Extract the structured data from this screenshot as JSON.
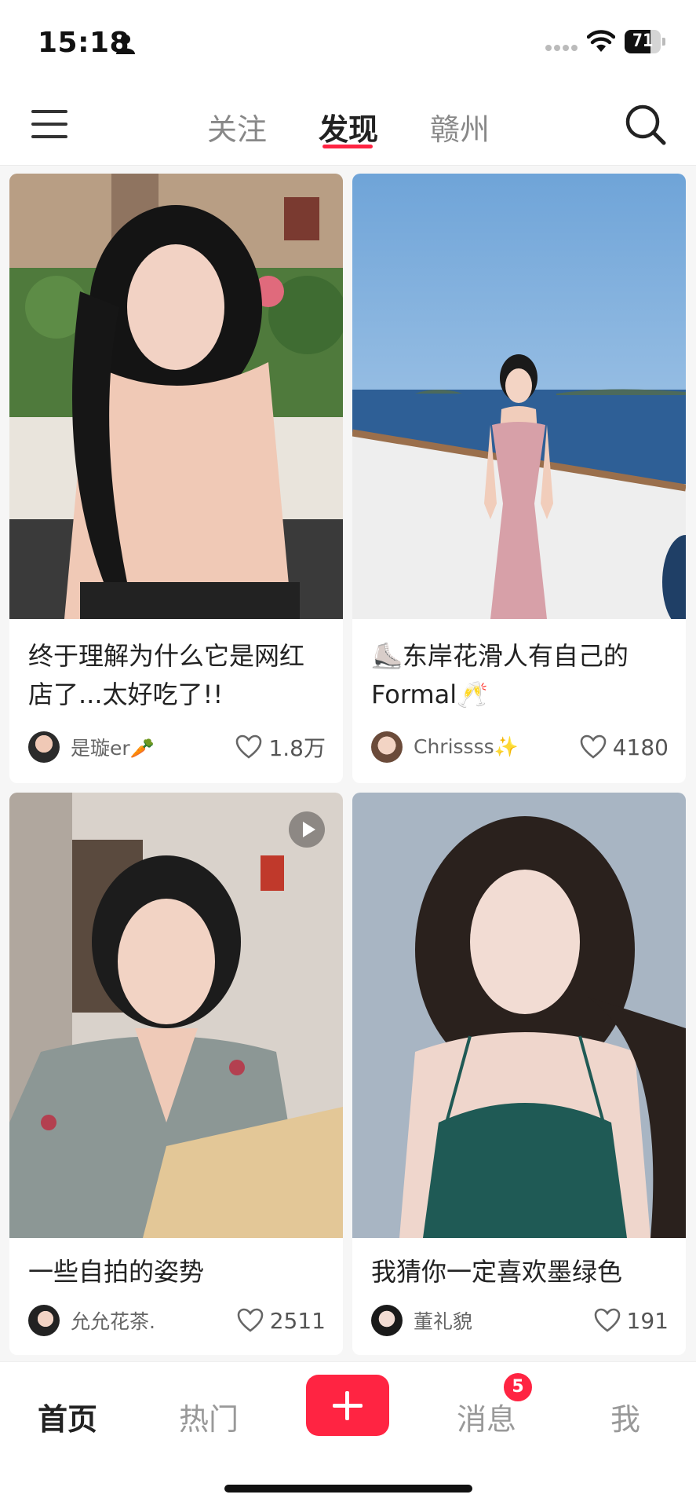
{
  "status_bar": {
    "time": "15:18",
    "battery": "71",
    "battery_level": 0.71
  },
  "top_nav": {
    "tabs": [
      {
        "label": "关注",
        "active": false
      },
      {
        "label": "发现",
        "active": true
      },
      {
        "label": "赣州",
        "active": false
      }
    ]
  },
  "feed": [
    {
      "title": "终于理解为什么它是网红店了...太好吃了!!",
      "author": "是璇er🥕",
      "likes": "1.8万",
      "image": "photo-woman-cafe",
      "has_video": false
    },
    {
      "title": "⛸️东岸花滑人有自己的Formal🥂",
      "author": "Chrissss✨",
      "likes": "4180",
      "image": "photo-woman-pink-dress-sea",
      "has_video": false
    },
    {
      "title": "一些自拍的姿势",
      "author": "允允花茶.",
      "likes": "2511",
      "image": "photo-woman-denim-selfie",
      "has_video": true
    },
    {
      "title": "我猜你一定喜欢墨绿色",
      "author": "董礼貌",
      "likes": "191",
      "image": "photo-woman-green-dress",
      "has_video": false
    }
  ],
  "bottom_nav": {
    "items": [
      {
        "label": "首页",
        "active": true
      },
      {
        "label": "热门",
        "active": false
      },
      {
        "label": "消息",
        "active": false,
        "badge": "5"
      },
      {
        "label": "我",
        "active": false
      }
    ]
  },
  "colors": {
    "accent": "#ff2442"
  }
}
